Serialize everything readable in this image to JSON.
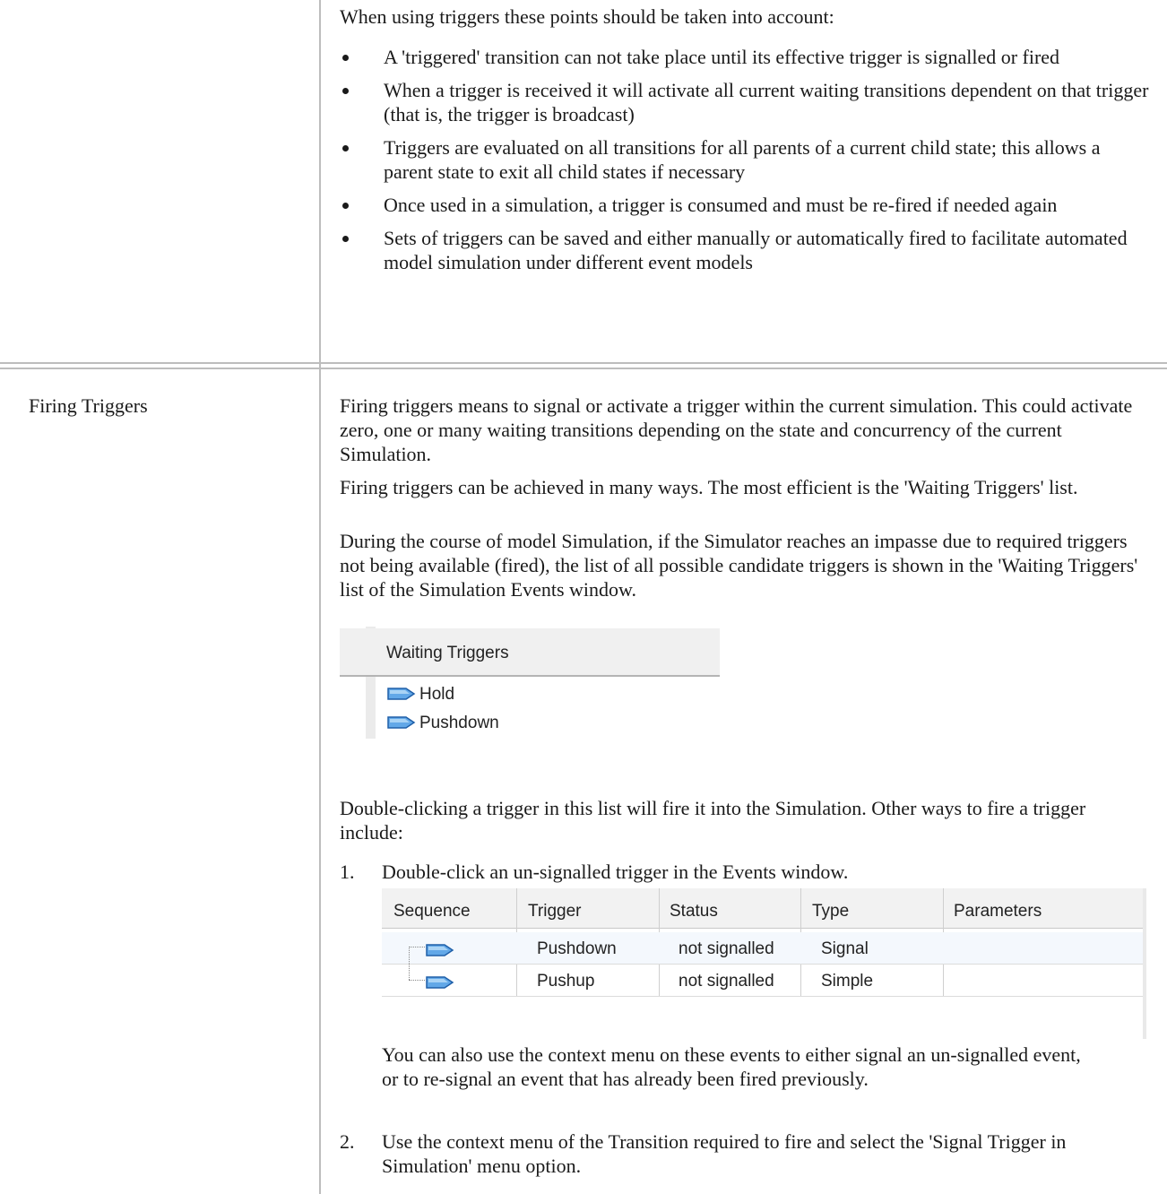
{
  "top_section": {
    "intro": "When using triggers these points should be taken into account:",
    "bullets": [
      "A 'triggered' transition can not take place until its effective trigger is signalled or fired",
      "When a trigger is received it will activate all current waiting transitions dependent on that trigger (that is, the trigger is broadcast)",
      "Triggers are evaluated on all transitions for all parents of a current child state; this allows a parent state to exit all child states if necessary",
      "Once used in a simulation, a trigger is consumed and must be re-fired if needed again",
      "Sets of triggers can be saved and either manually or automatically fired to facilitate automated model simulation under different event models"
    ]
  },
  "firing_section": {
    "label": "Firing Triggers",
    "para1": "Firing triggers means to signal or activate a trigger within the current simulation. This could activate zero, one or many waiting transitions depending on the state and concurrency of the current Simulation.",
    "para2": "Firing triggers can be achieved in many ways. The most efficient is the 'Waiting Triggers' list.",
    "para3": "During the course of model Simulation, if the Simulator reaches an impasse due to required triggers not being available (fired), the list of all possible candidate triggers is shown in the 'Waiting Triggers' list of the Simulation Events window.",
    "waiting_triggers": {
      "header": "Waiting Triggers",
      "items": [
        "Hold",
        "Pushdown"
      ],
      "icon": "signal-tag-icon"
    },
    "para4": "Double-clicking a trigger in this list will fire it into the Simulation. Other ways to fire a trigger include:",
    "steps": [
      {
        "num": "1.",
        "text": "Double-click an un-signalled trigger in the Events window."
      },
      {
        "num": "2.",
        "text": "Use the context menu of the Transition required to fire and select the 'Signal Trigger in Simulation' menu option."
      }
    ],
    "events_table": {
      "columns": [
        "Sequence",
        "Trigger",
        "Status",
        "Type",
        "Parameters"
      ],
      "rows": [
        {
          "trigger": "Pushdown",
          "status": "not signalled",
          "type": "Signal",
          "parameters": ""
        },
        {
          "trigger": "Pushup",
          "status": "not signalled",
          "type": "Simple",
          "parameters": ""
        }
      ]
    },
    "step1_note": "You can also use the context menu on these events to either signal an un-signalled event, or to re-signal an event that has already been fired previously."
  }
}
